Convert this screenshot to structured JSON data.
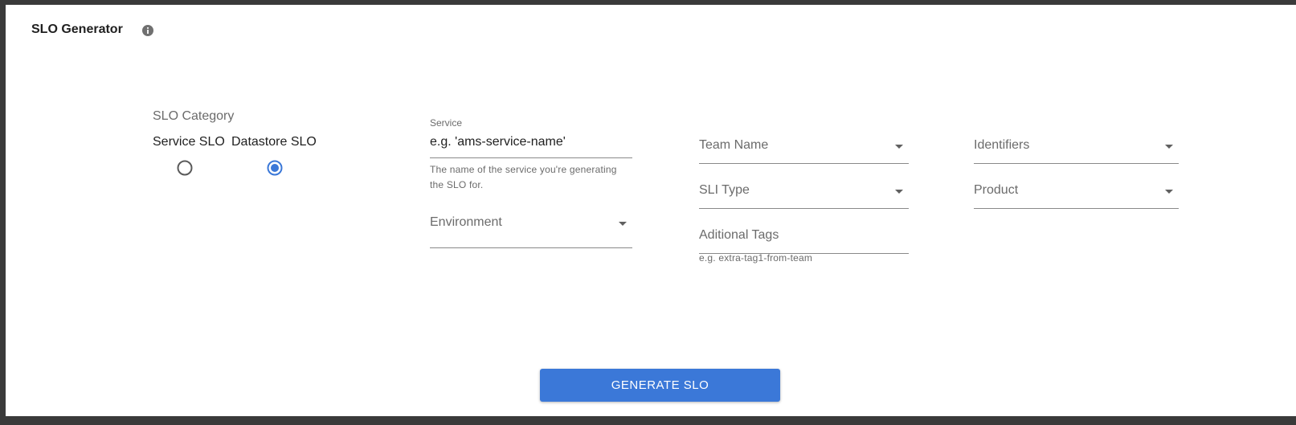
{
  "header": {
    "title": "SLO Generator",
    "info_icon": "info-icon"
  },
  "category": {
    "label": "SLO Category",
    "options": [
      {
        "label": "Service SLO",
        "selected": false
      },
      {
        "label": "Datastore SLO",
        "selected": true
      }
    ]
  },
  "fields": {
    "service": {
      "label": "Service",
      "placeholder": "e.g. 'ams-service-name'",
      "helper": "The name of the service you're generating the SLO for."
    },
    "environment": {
      "label": "Environment"
    },
    "team_name": {
      "label": "Team Name"
    },
    "sli_type": {
      "label": "SLI Type"
    },
    "additional_tags": {
      "label": "Aditional Tags",
      "helper": "e.g. extra-tag1-from-team"
    },
    "identifiers": {
      "label": "Identifiers"
    },
    "product": {
      "label": "Product"
    }
  },
  "actions": {
    "generate_label": "GENERATE SLO"
  },
  "colors": {
    "accent": "#3b78d8",
    "background": "#ffffff",
    "frame": "#3a3a3a"
  }
}
